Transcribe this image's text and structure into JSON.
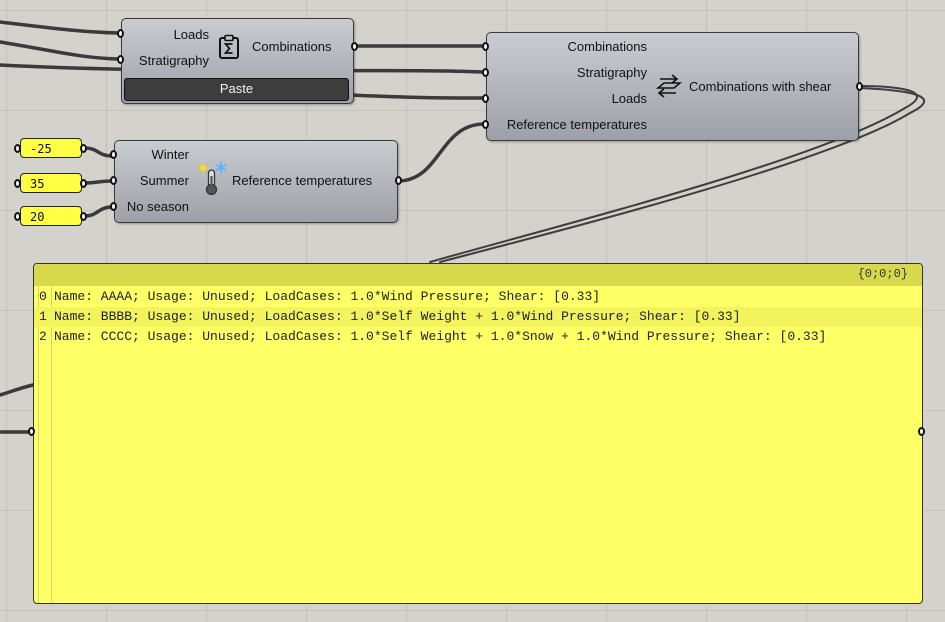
{
  "combine_node": {
    "inputs": [
      "Loads",
      "Stratigraphy"
    ],
    "output": "Combinations",
    "icon": "clipboard-sigma-icon",
    "button_label": "Paste"
  },
  "shear_node": {
    "inputs": [
      "Combinations",
      "Stratigraphy",
      "Loads",
      "Reference temperatures"
    ],
    "output": "Combinations with shear",
    "icon": "arrows-layers-icon"
  },
  "temp_node": {
    "inputs": [
      "Winter",
      "Summer",
      "No season"
    ],
    "output": "Reference temperatures",
    "icon": "thermometer-sun-snow-icon"
  },
  "number_inputs": [
    "-25",
    "35",
    "20"
  ],
  "panel": {
    "path": "{0;0;0}",
    "rows": [
      {
        "index": "0",
        "text": "Name: AAAA; Usage: Unused; LoadCases: 1.0*Wind Pressure; Shear: [0.33]"
      },
      {
        "index": "1",
        "text": "Name: BBBB; Usage: Unused; LoadCases: 1.0*Self Weight + 1.0*Wind Pressure; Shear: [0.33]"
      },
      {
        "index": "2",
        "text": "Name: CCCC; Usage: Unused; LoadCases: 1.0*Self Weight + 1.0*Snow + 1.0*Wind Pressure; Shear: [0.33]"
      }
    ]
  },
  "colors": {
    "canvas": "#d4d2cc",
    "node": "#b2b5ba",
    "panel": "#ffff66",
    "wire": "#4a4a4a"
  }
}
